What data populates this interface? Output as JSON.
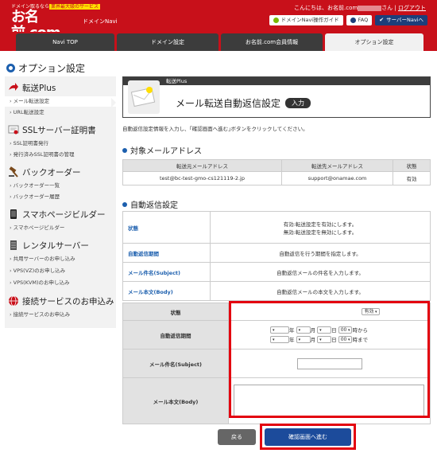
{
  "header": {
    "tagline_prefix": "ドメイン取るなら",
    "tagline_highlight": "業界最大級のサービス",
    "logo_main": "お名前",
    "logo_dot": ".",
    "logo_com": "com",
    "logo_by": "by GMO",
    "logo_url": "www.onamae.com",
    "sub_label": "ドメインNavi",
    "greeting_prefix": "こんにちは、お名前.com",
    "greeting_suffix": "さん",
    "logout": "ログアウト",
    "buttons": {
      "guide": "ドメインNavi操作ガイド",
      "faq": "FAQ",
      "server_navi": "サーバーNaviへ"
    },
    "colors": {
      "brand_red": "#c8101a",
      "navy": "#1c3e7a"
    }
  },
  "tabs": [
    {
      "label": "Navi TOP"
    },
    {
      "label": "ドメイン設定"
    },
    {
      "label": "お名前.com会員情報"
    },
    {
      "label": "オプション設定"
    }
  ],
  "page_title": "オプション設定",
  "sidebar": {
    "sections": [
      {
        "title": "転送Plus",
        "items": [
          "メール転送設定",
          "URL転送設定"
        ]
      },
      {
        "title": "SSLサーバー証明書",
        "items": [
          "SSL証明書発行",
          "発行済みSSL証明書の管理"
        ]
      },
      {
        "title": "バックオーダー",
        "items": [
          "バックオーダー一覧",
          "バックオーダー履歴"
        ]
      },
      {
        "title": "スマホページビルダー",
        "items": [
          "スマホページビルダー"
        ]
      },
      {
        "title": "レンタルサーバー",
        "items": [
          "共用サーバーのお申し込み",
          "VPS(VZ)のお申し込み",
          "VPS(KVM)のお申し込み"
        ]
      },
      {
        "title": "接続サービスのお申込み",
        "items": [
          "接続サービスのお申込み"
        ]
      }
    ]
  },
  "banner": {
    "category": "転送Plus",
    "title": "メール転送自動返信設定",
    "badge": "入力"
  },
  "description": "自動返信設定情報を入力し、｢確認画面へ進む｣ボタンをクリックしてください。",
  "target_section": {
    "title": "対象メールアドレス",
    "headers": [
      "転送元メールアドレス",
      "転送先メールアドレス",
      "状態"
    ],
    "row": [
      "test@bc-test-gmo-cs121119-2.jp",
      "support@onamae.com",
      "有効"
    ]
  },
  "auto_reply_section": {
    "title": "自動返信設定",
    "help_rows": [
      {
        "label": "状態",
        "line1": "有効:転送設定を有効にします。",
        "line2": "無効:転送設定を無効にします。"
      },
      {
        "label": "自動返信期間",
        "line1": "自動返信を行う期間を指定します。"
      },
      {
        "label": "メール件名(Subject)",
        "line1": "自動返信メールの件名を入力します。"
      },
      {
        "label": "メール本文(Body)",
        "line1": "自動返信メールの本文を入力します。"
      }
    ]
  },
  "form": {
    "status_label": "状態",
    "status_value": "有効",
    "period_label": "自動返信期間",
    "year_unit": "年",
    "month_unit": "月",
    "day_unit": "日",
    "hour_value": "00",
    "from_suffix": "時から",
    "to_suffix": "時まで",
    "subject_label": "メール件名(Subject)",
    "subject_value": "",
    "body_label": "メール本文(Body)",
    "body_value": ""
  },
  "buttons": {
    "back": "戻る",
    "next": "確認画面へ進む"
  },
  "highlight_color": "#e3000f"
}
